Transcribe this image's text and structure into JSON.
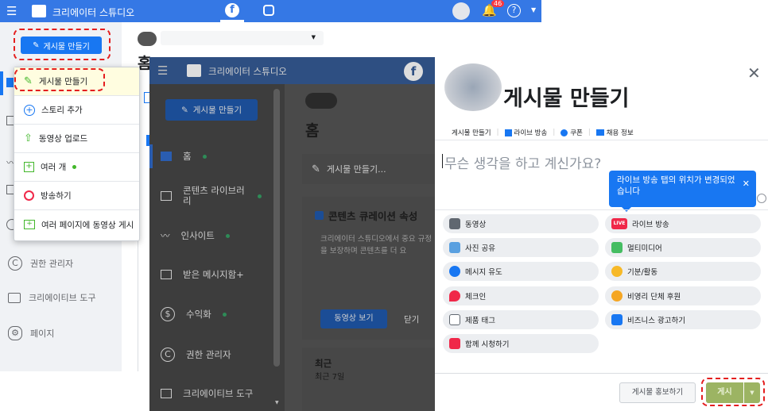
{
  "topbar": {
    "app_title": "크리에이터 스튜디오",
    "notif_count": "46"
  },
  "left": {
    "create_button": "게시물 만들기",
    "home_char": "홈",
    "items": [
      {
        "label": "권한 관리자"
      },
      {
        "label": "크리에이티브 도구"
      },
      {
        "label": "페이지"
      }
    ]
  },
  "dropdown": {
    "items": [
      {
        "label": "게시물 만들기"
      },
      {
        "label": "스토리 추가"
      },
      {
        "label": "동영상 업로드"
      },
      {
        "label": "여러 개"
      },
      {
        "label": "방송하기"
      },
      {
        "label": "여러 페이지에 동영상 게시"
      }
    ]
  },
  "bg2": {
    "app_title": "크리에이터 스튜디오",
    "create_button": "게시물 만들기",
    "home_title": "홈",
    "create_post_link": "게시물 만들기...",
    "nav": [
      {
        "label": "홈"
      },
      {
        "label": "콘텐츠 라이브러리"
      },
      {
        "label": "인사이트"
      },
      {
        "label": "받은 메시지함+"
      },
      {
        "label": "수익화"
      },
      {
        "label": "권한 관리자"
      },
      {
        "label": "크리에이티브 도구"
      }
    ],
    "curation_title": "콘텐츠 큐레이션 속성",
    "curation_body": "크리에이터 스튜디오에서 중요 규정을 보장하며 콘텐츠를 더 요",
    "watch_video": "동영상 보기",
    "close": "닫기",
    "recent_title": "최근",
    "recent_sub": "최근 7일"
  },
  "modal": {
    "title": "게시물 만들기",
    "tabs": [
      "게시물 만들기",
      "라이브 방송",
      "쿠폰",
      "채용 정보"
    ],
    "placeholder": "무슨 생각을 하고 계신가요?",
    "tooltip": "라이브 방송 탭의 위치가 변경되었습니다",
    "options_left": [
      {
        "label": "동영상"
      },
      {
        "label": "사진 공유"
      },
      {
        "label": "메시지 유도"
      },
      {
        "label": "체크인"
      },
      {
        "label": "제품 태그"
      },
      {
        "label": "함께 시청하기"
      }
    ],
    "options_right": [
      {
        "label": "라이브 방송"
      },
      {
        "label": "멀티미디어"
      },
      {
        "label": "기분/활동"
      },
      {
        "label": "비영리 단체 후원"
      },
      {
        "label": "비즈니스 광고하기"
      }
    ],
    "live_badge": "LIVE",
    "promote_button": "게시물 홍보하기",
    "post_button": "게시"
  }
}
